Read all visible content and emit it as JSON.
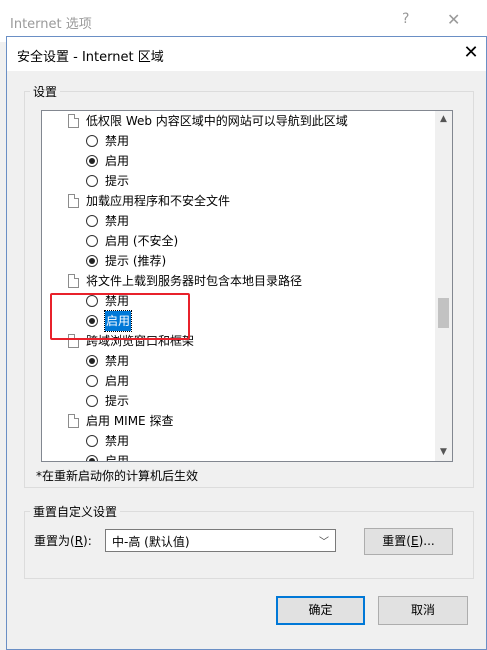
{
  "parent_window": {
    "title": "Internet 选项",
    "help_icon": "question-mark-icon",
    "close_icon": "close-icon"
  },
  "dialog": {
    "title": "安全设置 - Internet 区域",
    "close_glyph": "✕"
  },
  "settings_group": {
    "label": "设置",
    "items": [
      {
        "type": "header",
        "label": "低权限 Web 内容区域中的网站可以导航到此区域"
      },
      {
        "type": "option",
        "label": "禁用",
        "checked": false
      },
      {
        "type": "option",
        "label": "启用",
        "checked": true
      },
      {
        "type": "option",
        "label": "提示",
        "checked": false
      },
      {
        "type": "header",
        "label": "加载应用程序和不安全文件"
      },
      {
        "type": "option",
        "label": "禁用",
        "checked": false
      },
      {
        "type": "option",
        "label": "启用 (不安全)",
        "checked": false
      },
      {
        "type": "option",
        "label": "提示 (推荐)",
        "checked": true
      },
      {
        "type": "header",
        "label": "将文件上载到服务器时包含本地目录路径"
      },
      {
        "type": "option",
        "label": "禁用",
        "checked": false
      },
      {
        "type": "option",
        "label": "启用",
        "checked": true,
        "selected": true
      },
      {
        "type": "header",
        "label": "跨域浏览窗口和框架"
      },
      {
        "type": "option",
        "label": "禁用",
        "checked": true
      },
      {
        "type": "option",
        "label": "启用",
        "checked": false
      },
      {
        "type": "option",
        "label": "提示",
        "checked": false
      },
      {
        "type": "header",
        "label": "启用 MIME 探查"
      },
      {
        "type": "option",
        "label": "禁用",
        "checked": false
      },
      {
        "type": "option",
        "label": "启用",
        "checked": true
      }
    ],
    "note": "*在重新启动你的计算机后生效"
  },
  "reset_group": {
    "label": "重置自定义设置",
    "reset_to_label": "重置为",
    "reset_to_hotkey": "R",
    "combo_value": "中-高 (默认值)",
    "reset_button": "重置",
    "reset_button_hotkey": "E",
    "reset_button_suffix": "..."
  },
  "buttons": {
    "ok": "确定",
    "cancel": "取消"
  },
  "highlight_color": "#e8212b",
  "selection_color": "#0078d7"
}
